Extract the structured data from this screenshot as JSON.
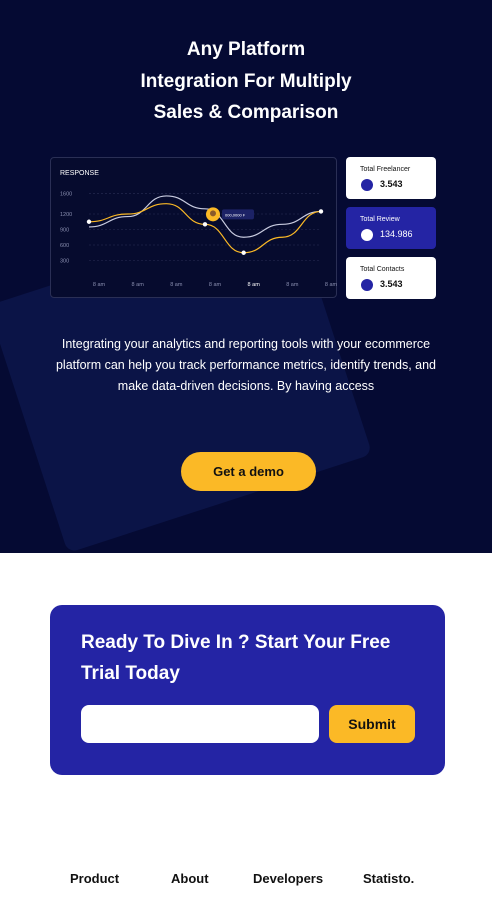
{
  "hero": {
    "title_lines": [
      "Any Platform",
      "Integration For Multiply",
      "Sales & Comparison"
    ],
    "description": "Integrating your analytics and reporting tools with your ecommerce platform can help you track performance metrics, identify trends, and make data-driven decisions. By having access",
    "demo_button": "Get a demo"
  },
  "chart_data": {
    "type": "line",
    "title": "RESPONSE",
    "yticks": [
      "1600",
      "1200",
      "900",
      "600",
      "300"
    ],
    "x": [
      "8 am",
      "8 am",
      "8 am",
      "8 am",
      "8 am",
      "8 am",
      "8 am"
    ],
    "highlight_x_index": 4,
    "series": [
      {
        "values": [
          950,
          1150,
          1550,
          1300,
          750,
          1000,
          1250
        ]
      },
      {
        "values": [
          1050,
          1200,
          1400,
          1000,
          450,
          750,
          1250
        ]
      }
    ],
    "tooltip_label": "000,0000 F",
    "ylim": [
      0,
      1800
    ]
  },
  "stats": [
    {
      "label": "Total Freelancer",
      "value": "3.543"
    },
    {
      "label": "Total Review",
      "value": "134.986"
    },
    {
      "label": "Total Contacts",
      "value": "3.543"
    }
  ],
  "cta": {
    "title": "Ready To Dive In ? Start Your Free Trial Today",
    "input_value": "",
    "input_placeholder": "",
    "submit_label": "Submit"
  },
  "footer": {
    "links": [
      "Product",
      "About",
      "Developers",
      "Statisto."
    ]
  },
  "colors": {
    "hero_bg": "#050a33",
    "accent_yellow": "#fbb926",
    "brand_blue": "#2424a4"
  }
}
